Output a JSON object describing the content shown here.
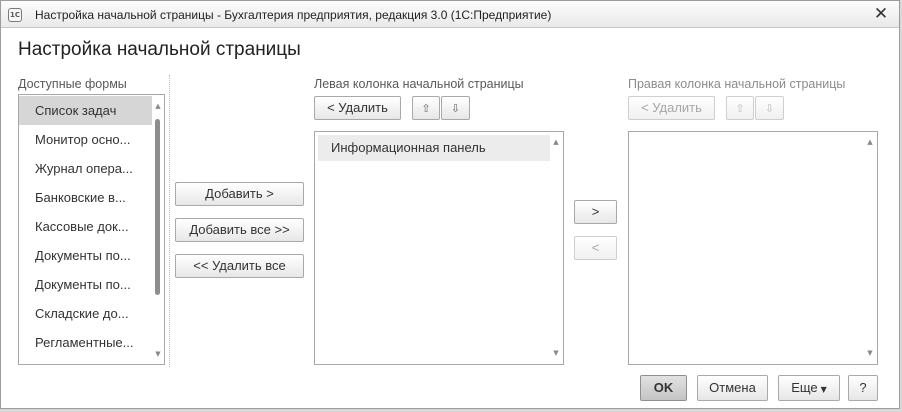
{
  "window": {
    "app_icon_text": "1С",
    "title": "Настройка начальной страницы - Бухгалтерия предприятия, редакция 3.0  (1С:Предприятие)",
    "close_glyph": "✕"
  },
  "page_title": "Настройка начальной страницы",
  "available_forms": {
    "label": "Доступные формы",
    "items": [
      "Список задач",
      "Монитор осно...",
      "Журнал опера...",
      "Банковские в...",
      "Кассовые док...",
      "Документы по...",
      "Документы по...",
      "Складские до...",
      "Регламентные..."
    ],
    "selected_index": 0
  },
  "middle_buttons": {
    "add": "Добавить >",
    "add_all": "Добавить все >>",
    "remove_all": "<< Удалить все"
  },
  "left_column": {
    "label": "Левая колонка начальной страницы",
    "remove": "< Удалить",
    "items": [
      "Информационная панель"
    ]
  },
  "transfer_buttons": {
    "to_right": ">",
    "to_left": "<"
  },
  "right_column": {
    "label": "Правая колонка начальной страницы",
    "remove": "< Удалить",
    "items": []
  },
  "icons": {
    "move_up": "up-arrow-icon",
    "move_down": "down-arrow-icon",
    "up_glyph": "⇧",
    "down_glyph": "⇩",
    "scroll_up_glyph": "▲",
    "scroll_down_glyph": "▼",
    "caret_glyph": "▼"
  },
  "footer": {
    "ok": "OK",
    "cancel": "Отмена",
    "more": "Еще",
    "help": "?"
  },
  "colors": {
    "selected_row": "#d6d6d6",
    "panel_item": "#ececec",
    "ok_button": "#c4c4c4"
  }
}
